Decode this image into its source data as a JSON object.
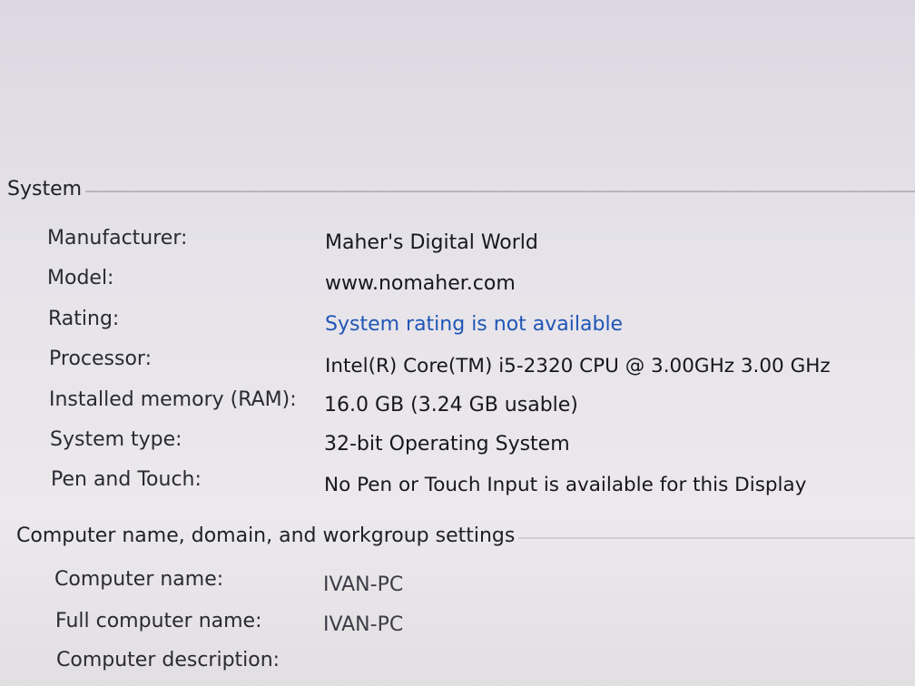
{
  "system": {
    "header": "System",
    "rows": [
      {
        "label": "Manufacturer:",
        "value": "Maher's Digital World"
      },
      {
        "label": "Model:",
        "value": "www.nomaher.com"
      },
      {
        "label": "Rating:",
        "value": "System rating is not available"
      },
      {
        "label": "Processor:",
        "value": "Intel(R) Core(TM) i5-2320 CPU @ 3.00GHz   3.00 GHz"
      },
      {
        "label": "Installed memory (RAM):",
        "value": "16.0 GB (3.24 GB usable)"
      },
      {
        "label": "System type:",
        "value": "32-bit Operating System"
      },
      {
        "label": "Pen and Touch:",
        "value": "No Pen or Touch Input is available for this Display"
      }
    ]
  },
  "computer": {
    "header": "Computer name, domain, and workgroup settings",
    "rows": [
      {
        "label": "Computer name:",
        "value": "IVAN-PC"
      },
      {
        "label": "Full computer name:",
        "value": "IVAN-PC"
      },
      {
        "label": "Computer description:",
        "value": ""
      }
    ]
  },
  "colors": {
    "link": "#1f56b5",
    "text": "#17171d",
    "background": "#e6e3ea"
  }
}
